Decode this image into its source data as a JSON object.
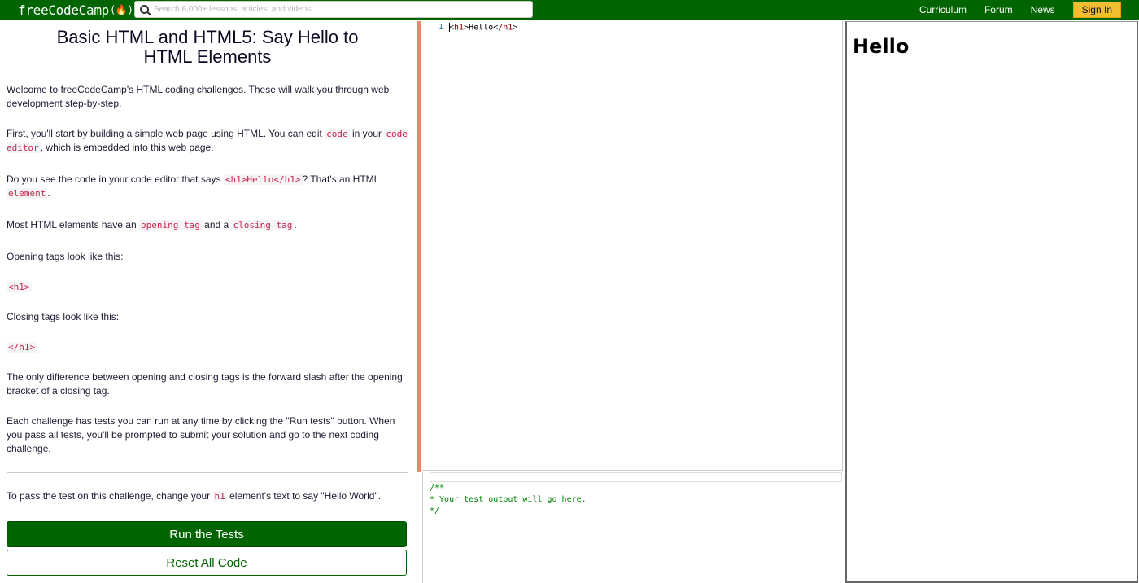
{
  "navbar": {
    "logo": "freeCodeCamp",
    "logo_flame": "(🔥)",
    "search_placeholder": "Search 8,000+ lessons, articles, and videos",
    "links": [
      "Curriculum",
      "Forum",
      "News"
    ],
    "signin_label": "Sign In",
    "brand_color": "#006400",
    "signin_color": "#f1be32"
  },
  "lesson": {
    "title": "Basic HTML and HTML5: Say Hello to HTML Elements",
    "p1": "Welcome to freeCodeCamp's HTML coding challenges. These will walk you through web development step-by-step.",
    "p2_a": "First, you'll start by building a simple web page using HTML. You can edit ",
    "p2_code1": "code",
    "p2_b": " in your ",
    "p2_code2": "code editor",
    "p2_c": ", which is embedded into this web page.",
    "p3_a": "Do you see the code in your code editor that says ",
    "p3_code1": "<h1>Hello</h1>",
    "p3_b": "? That's an HTML ",
    "p3_code2": "element",
    "p3_c": ".",
    "p4_a": "Most HTML elements have an ",
    "p4_code1": "opening tag",
    "p4_b": " and a ",
    "p4_code2": "closing tag",
    "p4_c": ".",
    "p5": "Opening tags look like this:",
    "p5_code": "<h1>",
    "p6": "Closing tags look like this:",
    "p6_code": "</h1>",
    "p7": "The only difference between opening and closing tags is the forward slash after the opening bracket of a closing tag.",
    "p8": "Each challenge has tests you can run at any time by clicking the \"Run tests\" button. When you pass all tests, you'll be prompted to submit your solution and go to the next coding challenge.",
    "task_a": "To pass the test on this challenge, change your ",
    "task_code": "h1",
    "task_b": " element's text to say \"Hello World\".",
    "run_label": "Run the Tests",
    "reset_label": "Reset All Code"
  },
  "editor": {
    "line_number": "1",
    "tag_open": "h1",
    "text": "Hello",
    "tag_close": "/h1"
  },
  "output": {
    "text": "/**\n* Your test output will go here.\n*/"
  },
  "preview": {
    "heading": "Hello"
  }
}
